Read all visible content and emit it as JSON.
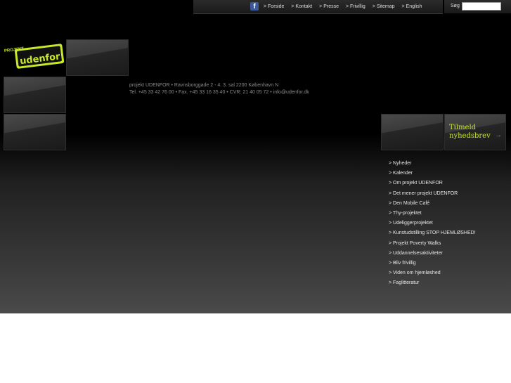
{
  "topnav": {
    "facebook_icon_glyph": "f",
    "items": [
      "> Forside",
      "> Kontakt",
      "> Presse",
      "> Frivillig",
      "> Sitemap",
      "> English"
    ]
  },
  "search": {
    "label": "Søg",
    "value": ""
  },
  "logo": {
    "line1": "PROJEKT",
    "line2": "udenfor"
  },
  "address": {
    "line1": "projekt UDENFOR • Ravnsborggade 2 - 4. 3. sal 2200 København N",
    "line2": "Tel. +45 33 42 76 00 • Fax. +45 33 16 35 40 • CVR: 21 40 05 72 • info@udenfor.dk"
  },
  "newsletter": {
    "line1": "Tilmeld",
    "line2": "nyhedsbrev",
    "arrow": "→"
  },
  "sidemenu": {
    "items": [
      "> Nyheder",
      "> Kalender",
      "> Om projekt UDENFOR",
      "> Det mener projekt UDENFOR",
      "> Den Mobile Café",
      "> Thy-projektet",
      "> Udeliggerprojektet",
      "> Kunstudstilling STOP HJEMLØSHED!",
      "> Projekt Poverty Walks",
      "> Uddannelsesaktiviteter",
      "> Bliv frivillig",
      "> Viden om hjemløshed",
      "> Faglitteratur"
    ]
  },
  "colors": {
    "accent": "#c8e82a",
    "facebook": "#3b5998"
  }
}
